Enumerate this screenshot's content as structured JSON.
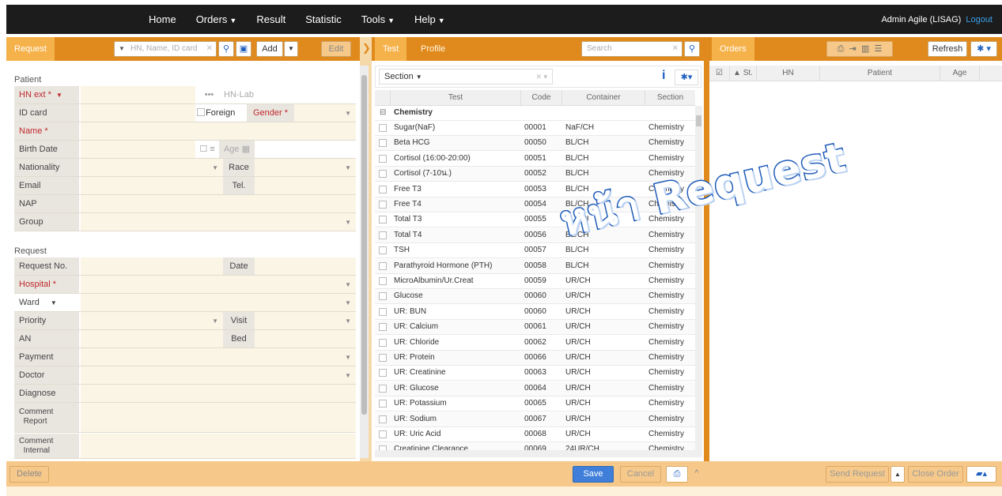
{
  "nav": {
    "menu": [
      {
        "label": "Home",
        "dropdown": false
      },
      {
        "label": "Orders",
        "dropdown": true
      },
      {
        "label": "Result",
        "dropdown": false
      },
      {
        "label": "Statistic",
        "dropdown": false
      },
      {
        "label": "Tools",
        "dropdown": true
      },
      {
        "label": "Help",
        "dropdown": true
      }
    ],
    "user": "Admin Agile (LISAG)",
    "logout": "Logout"
  },
  "request_panel": {
    "tab": "Request",
    "search_placeholder": "HN, Name, ID card",
    "add_label": "Add",
    "edit_label": "Edit"
  },
  "test_panel": {
    "tabs": [
      "Test",
      "Profile"
    ],
    "search_placeholder": "Search",
    "section_label": "Section",
    "columns": [
      "Test",
      "Code",
      "Container",
      "Section"
    ],
    "group": "Chemistry",
    "rows": [
      [
        "Sugar(NaF)",
        "00001",
        "NaF/CH",
        "Chemistry"
      ],
      [
        "Beta HCG",
        "00050",
        "BL/CH",
        "Chemistry"
      ],
      [
        "Cortisol (16:00-20:00)",
        "00051",
        "BL/CH",
        "Chemistry"
      ],
      [
        "Cortisol (7-10น.)",
        "00052",
        "BL/CH",
        "Chemistry"
      ],
      [
        "Free T3",
        "00053",
        "BL/CH",
        "Chemistry"
      ],
      [
        "Free T4",
        "00054",
        "BL/CH",
        "Chemistry"
      ],
      [
        "Total T3",
        "00055",
        "BL/CH",
        "Chemistry"
      ],
      [
        "Total T4",
        "00056",
        "BL/CH",
        "Chemistry"
      ],
      [
        "TSH",
        "00057",
        "BL/CH",
        "Chemistry"
      ],
      [
        "Parathyroid Hormone (PTH)",
        "00058",
        "BL/CH",
        "Chemistry"
      ],
      [
        "MicroAlbumin/Ur.Creat",
        "00059",
        "UR/CH",
        "Chemistry"
      ],
      [
        "Glucose",
        "00060",
        "UR/CH",
        "Chemistry"
      ],
      [
        "UR: BUN",
        "00060",
        "UR/CH",
        "Chemistry"
      ],
      [
        "UR: Calcium",
        "00061",
        "UR/CH",
        "Chemistry"
      ],
      [
        "UR: Chloride",
        "00062",
        "UR/CH",
        "Chemistry"
      ],
      [
        "UR: Protein",
        "00066",
        "UR/CH",
        "Chemistry"
      ],
      [
        "UR: Creatinine",
        "00063",
        "UR/CH",
        "Chemistry"
      ],
      [
        "UR: Glucose",
        "00064",
        "UR/CH",
        "Chemistry"
      ],
      [
        "UR: Potassium",
        "00065",
        "UR/CH",
        "Chemistry"
      ],
      [
        "UR: Sodium",
        "00067",
        "UR/CH",
        "Chemistry"
      ],
      [
        "UR: Uric Acid",
        "00068",
        "UR/CH",
        "Chemistry"
      ],
      [
        "Creatinine Clearance",
        "00069",
        "24UR/CH",
        "Chemistry"
      ]
    ]
  },
  "orders_panel": {
    "tab": "Orders",
    "refresh_label": "Refresh",
    "columns": [
      "St.",
      "HN",
      "Patient",
      "Age"
    ]
  },
  "form": {
    "patient_title": "Patient",
    "request_title": "Request",
    "labels": {
      "hn_ext": "HN ext *",
      "hn_lab": "HN-Lab",
      "id_card": "ID card",
      "foreign": "Foreign",
      "gender": "Gender *",
      "name": "Name *",
      "birth_date": "Birth Date",
      "age": "Age",
      "nationality": "Nationality",
      "race": "Race",
      "email": "Email",
      "tel": "Tel.",
      "nap": "NAP",
      "group": "Group",
      "request_no": "Request No.",
      "date": "Date",
      "hospital": "Hospital *",
      "ward": "Ward",
      "priority": "Priority",
      "visit": "Visit",
      "an": "AN",
      "bed": "Bed",
      "payment": "Payment",
      "doctor": "Doctor",
      "diagnose": "Diagnose",
      "comment_report_1": "Comment",
      "comment_report_2": "Report",
      "comment_internal_1": "Comment",
      "comment_internal_2": "Internal"
    }
  },
  "bottom": {
    "delete": "Delete",
    "save": "Save",
    "cancel": "Cancel",
    "send_request": "Send Request",
    "close_order": "Close Order"
  },
  "watermark": "หน้า Request",
  "colors": {
    "accent": "#e08a1e",
    "navbar": "#1c1c1c",
    "save": "#3f7fd9",
    "required": "#c0282b"
  }
}
